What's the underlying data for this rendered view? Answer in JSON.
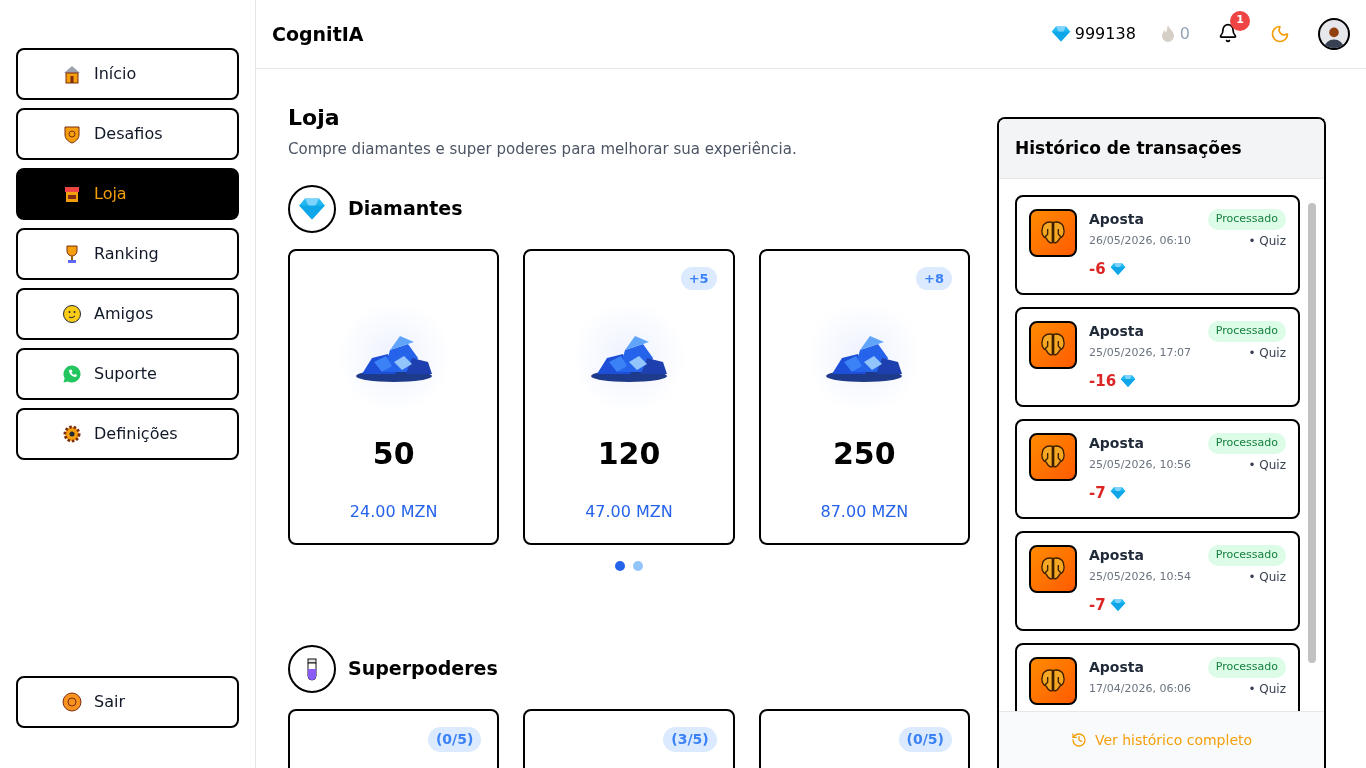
{
  "app": {
    "title": "CognitIA"
  },
  "header": {
    "diamonds": "999138",
    "streak": "0",
    "notifications": "1"
  },
  "sidebar": {
    "items": [
      {
        "label": "Início",
        "kind": "home",
        "selected": false
      },
      {
        "label": "Desafios",
        "kind": "challenges",
        "selected": false
      },
      {
        "label": "Loja",
        "kind": "shop",
        "selected": true
      },
      {
        "label": "Ranking",
        "kind": "ranking",
        "selected": false
      },
      {
        "label": "Amigos",
        "kind": "friends",
        "selected": false
      },
      {
        "label": "Suporte",
        "kind": "support",
        "selected": false
      },
      {
        "label": "Definições",
        "kind": "settings",
        "selected": false
      }
    ],
    "logout": "Sair"
  },
  "page": {
    "title": "Loja",
    "subtitle": "Compre diamantes e super poderes para melhorar sua experiência."
  },
  "diamonds": {
    "title": "Diamantes",
    "packs": [
      {
        "amount": "50",
        "price": "24.00 MZN"
      },
      {
        "amount": "120",
        "price": "47.00 MZN",
        "bonus": "+5"
      },
      {
        "amount": "250",
        "price": "87.00 MZN",
        "bonus": "+8"
      }
    ],
    "pages": [
      {
        "selected": true
      },
      {
        "selected": false
      }
    ]
  },
  "superpowers": {
    "title": "Superpoderes",
    "cards": [
      {
        "badge": "(0/5)"
      },
      {
        "badge": "(3/5)"
      },
      {
        "badge": "(0/5)"
      }
    ]
  },
  "history": {
    "title": "Histórico de transações",
    "items": [
      {
        "title": "Aposta",
        "status": "Processado",
        "date": "26/05/2026, 06:10",
        "category": "• Quiz",
        "amount": "-6"
      },
      {
        "title": "Aposta",
        "status": "Processado",
        "date": "25/05/2026, 17:07",
        "category": "• Quiz",
        "amount": "-16"
      },
      {
        "title": "Aposta",
        "status": "Processado",
        "date": "25/05/2026, 10:56",
        "category": "• Quiz",
        "amount": "-7"
      },
      {
        "title": "Aposta",
        "status": "Processado",
        "date": "25/05/2026, 10:54",
        "category": "• Quiz",
        "amount": "-7"
      },
      {
        "title": "Aposta",
        "status": "Processado",
        "date": "17/04/2026, 06:06",
        "category": "• Quiz"
      }
    ],
    "link": "Ver histórico completo"
  }
}
